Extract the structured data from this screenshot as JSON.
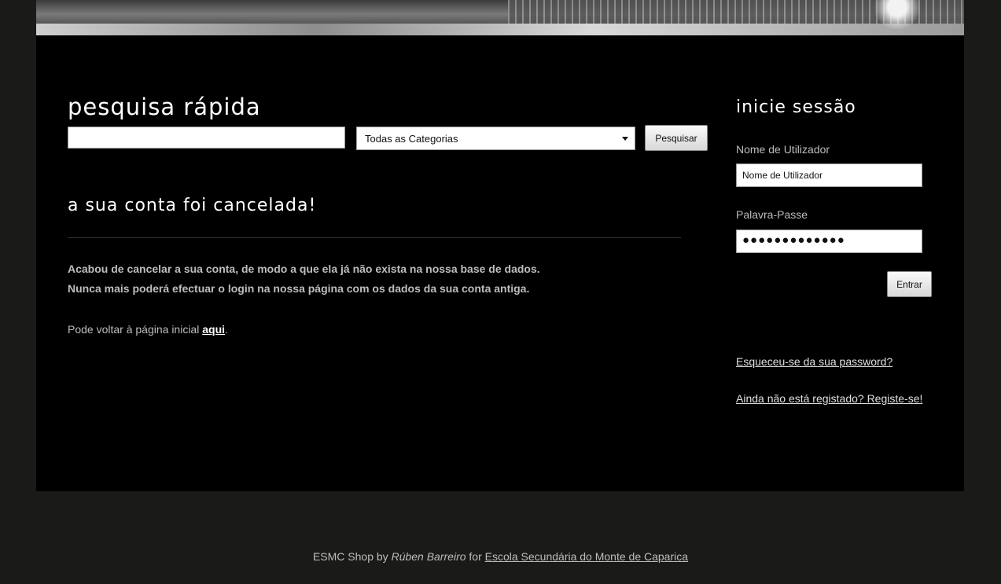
{
  "search": {
    "title": "pesquisa rápida",
    "query_value": "",
    "category_selected": "Todas as Categorias",
    "button_label": "Pesquisar"
  },
  "content": {
    "title": "a sua conta foi cancelada!",
    "message_line1": "Acabou de cancelar a sua conta, de modo a que ela já não exista na nossa base de dados.",
    "message_line2": "Nunca mais poderá efectuar o login na nossa página com os dados da sua conta antiga.",
    "back_text": "Pode voltar à página inicial ",
    "back_link": "aqui",
    "back_end": "."
  },
  "login": {
    "title": "inicie sessão",
    "username_label": "Nome de Utilizador",
    "username_value": "Nome de Utilizador",
    "password_label": "Palavra-Passe",
    "password_value": "●●●●●●●●●●●●●",
    "button_label": "Entrar",
    "forgot_link": "Esqueceu-se da sua password?",
    "register_link": "Ainda não está registado? Registe-se!"
  },
  "footer": {
    "prefix": "ESMC Shop by ",
    "author": "Rúben Barreiro",
    "middle": " for ",
    "school": "Escola Secundária do Monte de Caparica"
  }
}
